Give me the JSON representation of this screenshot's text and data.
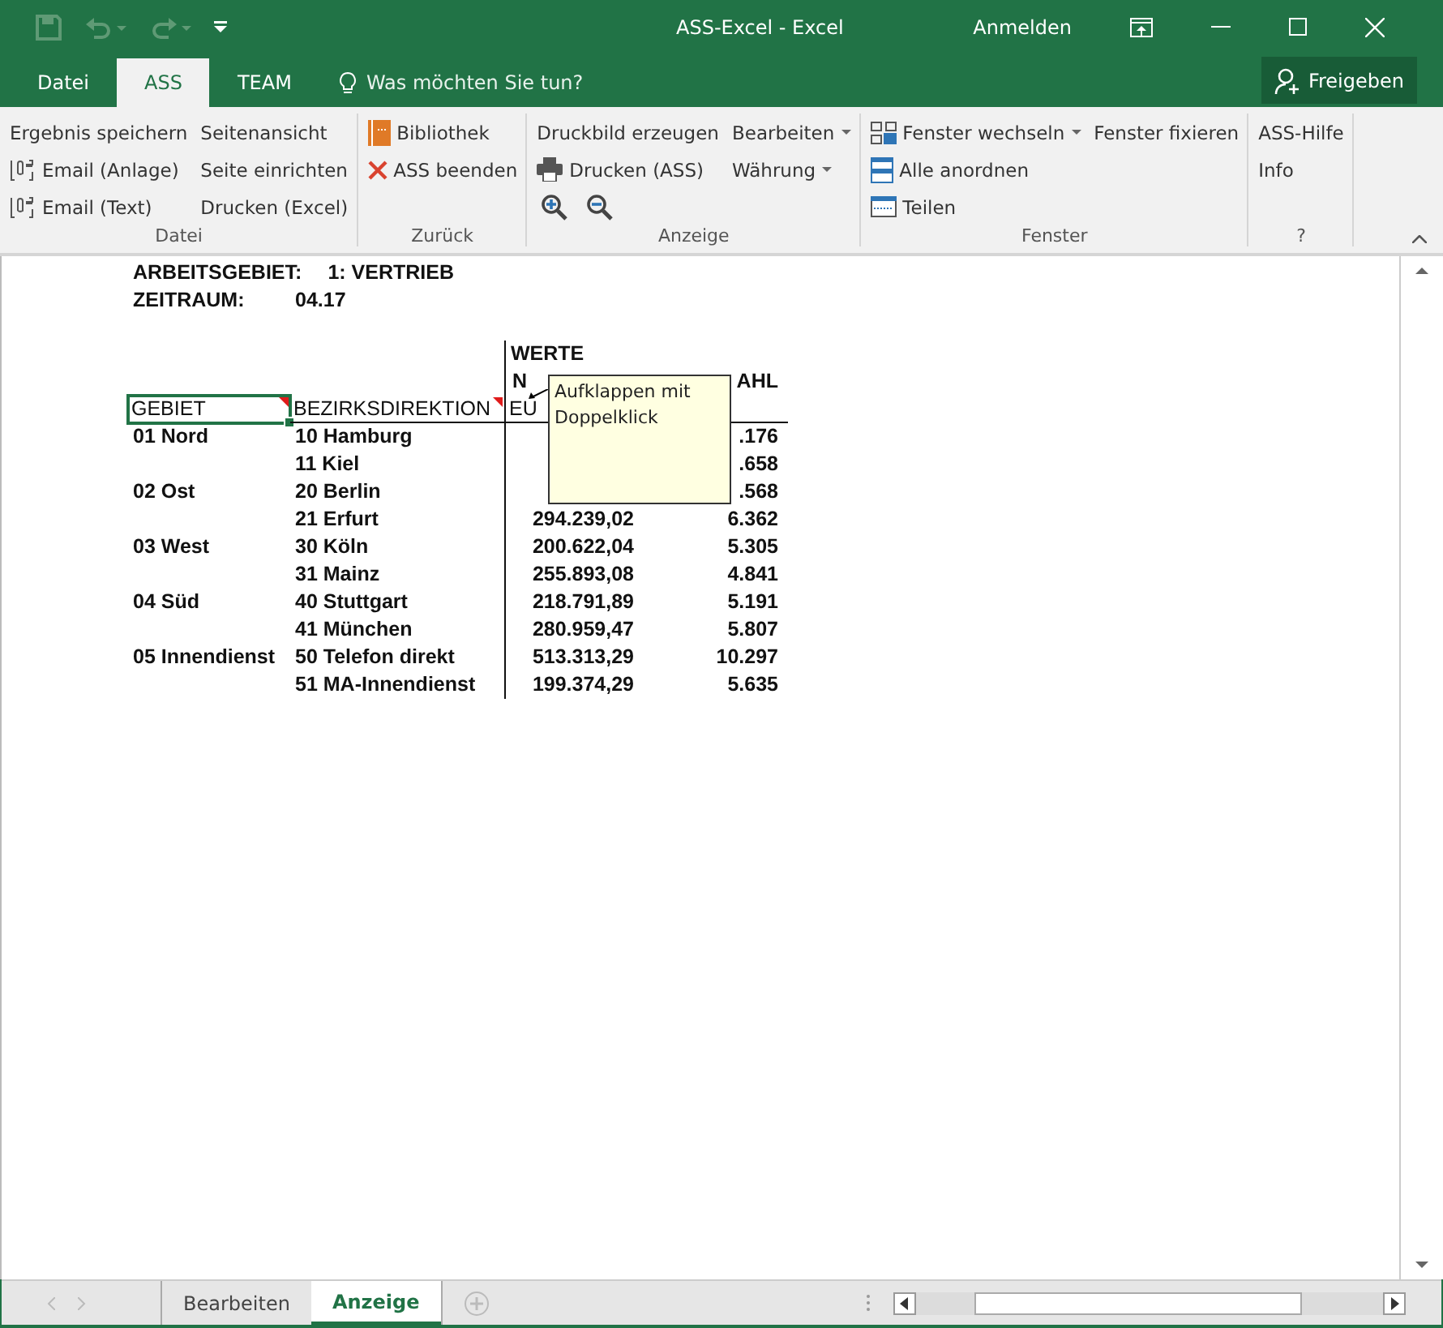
{
  "window": {
    "title": "ASS-Excel  -  Excel",
    "sign_in": "Anmelden"
  },
  "tabs": [
    {
      "label": "Datei",
      "selected": false
    },
    {
      "label": "ASS",
      "selected": true
    },
    {
      "label": "TEAM",
      "selected": false
    }
  ],
  "tell_me": {
    "placeholder": "Was möchten Sie tun?"
  },
  "share_button": "Freigeben",
  "ribbon": [
    {
      "label": "Datei",
      "columns": [
        [
          {
            "text": "Ergebnis speichern"
          },
          {
            "text": "Email (Anlage)",
            "kind": "attach"
          },
          {
            "text": "Email (Text)",
            "kind": "attach"
          }
        ],
        [
          {
            "text": "Seitenansicht"
          },
          {
            "text": "Seite einrichten"
          },
          {
            "text": "Drucken (Excel)"
          }
        ]
      ]
    },
    {
      "label": "Zurück",
      "columns": [
        [
          {
            "text": "Bibliothek",
            "kind": "book"
          },
          {
            "text": "ASS beenden",
            "kind": "close"
          }
        ]
      ]
    },
    {
      "label": "Anzeige",
      "columns": [
        [
          {
            "text": "Druckbild erzeugen"
          },
          {
            "text": "Drucken (ASS)",
            "kind": "print"
          },
          {
            "kind": "zoom"
          }
        ],
        [
          {
            "text": "Bearbeiten",
            "dropdown": true
          },
          {
            "text": "Währung",
            "dropdown": true
          }
        ]
      ]
    },
    {
      "label": "Fenster",
      "columns": [
        [
          {
            "text": "Fenster wechseln",
            "kind": "switch",
            "dropdown": true
          },
          {
            "text": "Alle anordnen",
            "kind": "arrange"
          },
          {
            "text": "Teilen",
            "kind": "split"
          }
        ],
        [
          {
            "text": "Fenster fixieren"
          }
        ]
      ]
    },
    {
      "label": "?",
      "columns": [
        [
          {
            "text": "ASS-Hilfe"
          },
          {
            "text": "Info"
          }
        ]
      ]
    }
  ],
  "sheet": {
    "info": [
      {
        "label": "ARBEITSGEBIET:",
        "value": "1: VERTRIEB"
      },
      {
        "label": "ZEITRAUM:",
        "value": "04.17"
      }
    ],
    "values_label": "WERTE",
    "subheader": {
      "beitrag": "N",
      "anzahl": "AHL"
    },
    "header": [
      {
        "text": "GEBIET",
        "selected": true,
        "comment": true
      },
      {
        "text": "BEZIRKSDIREKTION",
        "selected": false,
        "comment": true
      },
      {
        "text": "EU",
        "selected": false
      }
    ],
    "rows": [
      {
        "gebiet": "01 Nord",
        "bezirk": "10 Hamburg",
        "anzahl": ".176"
      },
      {
        "bezirk": "11 Kiel",
        "anzahl": ".658"
      },
      {
        "gebiet": "02 Ost",
        "bezirk": "20 Berlin",
        "anzahl": ".568"
      },
      {
        "bezirk": "21 Erfurt",
        "beitrag": "294.239,02",
        "anzahl": "6.362"
      },
      {
        "gebiet": "03 West",
        "bezirk": "30 Köln",
        "beitrag": "200.622,04",
        "anzahl": "5.305"
      },
      {
        "bezirk": "31 Mainz",
        "beitrag": "255.893,08",
        "anzahl": "4.841"
      },
      {
        "gebiet": "04 Süd",
        "bezirk": "40 Stuttgart",
        "beitrag": "218.791,89",
        "anzahl": "5.191"
      },
      {
        "bezirk": "41 München",
        "beitrag": "280.959,47",
        "anzahl": "5.807"
      },
      {
        "gebiet": "05 Innendienst",
        "bezirk": "50 Telefon direkt",
        "beitrag": "513.313,29",
        "anzahl": "10.297"
      },
      {
        "bezirk": "51 MA-Innendienst",
        "beitrag": "199.374,29",
        "anzahl": "5.635"
      }
    ],
    "tooltip": "Aufklappen mit Doppelklick"
  },
  "sheet_tabs": [
    {
      "label": "Bearbeiten",
      "selected": false
    },
    {
      "label": "Anzeige",
      "selected": true
    }
  ]
}
